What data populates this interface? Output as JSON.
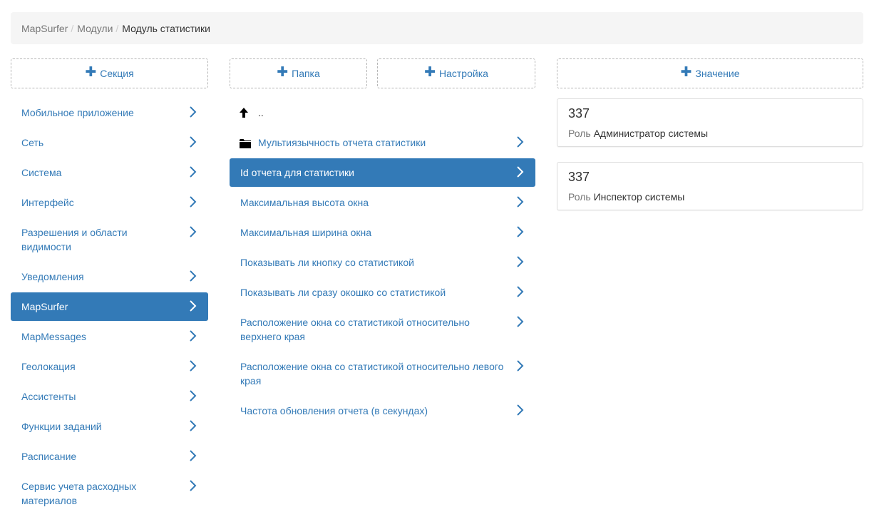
{
  "breadcrumb": {
    "items": [
      "MapSurfer",
      "Модули"
    ],
    "current": "Модуль статистики"
  },
  "left": {
    "add_label": "Секция",
    "items": [
      {
        "label": "Мобильное приложение"
      },
      {
        "label": "Сеть"
      },
      {
        "label": "Система"
      },
      {
        "label": "Интерфейс"
      },
      {
        "label": "Разрешения и области видимости"
      },
      {
        "label": "Уведомления"
      },
      {
        "label": "MapSurfer",
        "active": true
      },
      {
        "label": "MapMessages"
      },
      {
        "label": "Геолокация"
      },
      {
        "label": "Ассистенты"
      },
      {
        "label": "Функции заданий"
      },
      {
        "label": "Расписание"
      },
      {
        "label": "Сервис учета расходных материалов"
      }
    ]
  },
  "middle": {
    "add_folder_label": "Папка",
    "add_setting_label": "Настройка",
    "up_label": "..",
    "folder": {
      "label": "Мультиязычность отчета статистики",
      "icon": "folder-icon"
    },
    "items": [
      {
        "label": "Id отчета для статистики",
        "active": true
      },
      {
        "label": "Максимальная высота окна"
      },
      {
        "label": "Максимальная ширина окна"
      },
      {
        "label": "Показывать ли кнопку со статистикой"
      },
      {
        "label": "Показывать ли сразу окошко со статистикой"
      },
      {
        "label": "Расположение окна со статистикой относительно верхнего края"
      },
      {
        "label": "Расположение окна со статистикой относительно левого края"
      },
      {
        "label": "Частота обновления отчета (в секундах)"
      }
    ]
  },
  "right": {
    "add_label": "Значение",
    "values": [
      {
        "value": "337",
        "role_label": "Роль",
        "role": "Администратор системы"
      },
      {
        "value": "337",
        "role_label": "Роль",
        "role": "Инспектор системы"
      }
    ]
  },
  "colors": {
    "accent": "#337ab7",
    "active_text": "#ffffff"
  }
}
